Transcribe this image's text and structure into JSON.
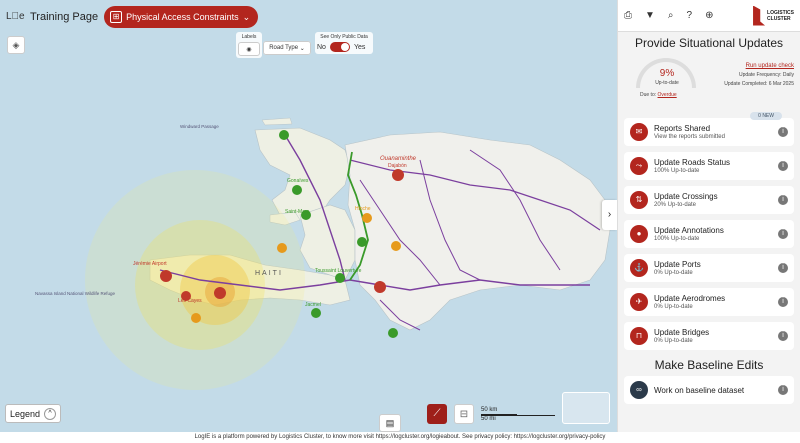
{
  "header": {
    "page_title": "Training Page",
    "layer_button_label": "Physical Access Constraints",
    "logo_text": "L⃝e"
  },
  "map_controls": {
    "labels_caption": "Labels",
    "road_type_label": "Road Type",
    "public_caption": "See Only Public Data",
    "toggle_no": "No",
    "toggle_yes": "Yes",
    "legend_label": "Legend",
    "scale_km": "50 km",
    "scale_mi": "50 mi"
  },
  "map_labels": {
    "haiti": "HAITI",
    "ouanaminthe": "Ouanaminthe",
    "dajabon": "Dajabón",
    "gonaives": "Gonaïves",
    "saint_marc": "Saint-Marc",
    "hinche": "Hinche",
    "les_cayes": "Les Cayes",
    "jeremie": "Jérémie Airport",
    "jacmel": "Jacmel",
    "toussaint": "Toussaint Louverture",
    "navassa": "Navassa Island National Wildlife Refuge",
    "ocean": "Windward Passage"
  },
  "panel": {
    "title": "Provide Situational Updates",
    "percent": "9%",
    "up_to_date": "Up-to-date",
    "due_label": "Due to:",
    "due_value": "Overdue",
    "run_check": "Run update check",
    "frequency": "Update Frequency: Daily",
    "completed": "Update Completed: 6 Mar 2025",
    "new_badge": "0 NEW",
    "items": [
      {
        "title": "Reports Shared",
        "sub": "View the reports submitted",
        "icon": "chat-icon"
      },
      {
        "title": "Update Roads Status",
        "sub": "100% Up-to-date",
        "icon": "road-icon"
      },
      {
        "title": "Update Crossings",
        "sub": "20% Up-to-date",
        "icon": "crossing-icon"
      },
      {
        "title": "Update Annotations",
        "sub": "100% Up-to-date",
        "icon": "pin-icon"
      },
      {
        "title": "Update Ports",
        "sub": "0% Up-to-date",
        "icon": "anchor-icon"
      },
      {
        "title": "Update Aerodromes",
        "sub": "0% Up-to-date",
        "icon": "plane-icon"
      },
      {
        "title": "Update Bridges",
        "sub": "0% Up-to-date",
        "icon": "bridge-icon"
      }
    ],
    "baseline_title": "Make Baseline Edits",
    "baseline_item": "Work on baseline dataset"
  },
  "footer": {
    "text": "LogIE is a platform powered by Logistics Cluster, to know more visit https://logcluster.org/logieabout. See privacy policy: https://logcluster.org/privacy-policy"
  },
  "colors": {
    "accent": "#b3261e",
    "sea": "#c3dbe8",
    "land": "#eef0e4",
    "road_purple": "#7b3f9e",
    "road_green": "#3a9a2a"
  }
}
